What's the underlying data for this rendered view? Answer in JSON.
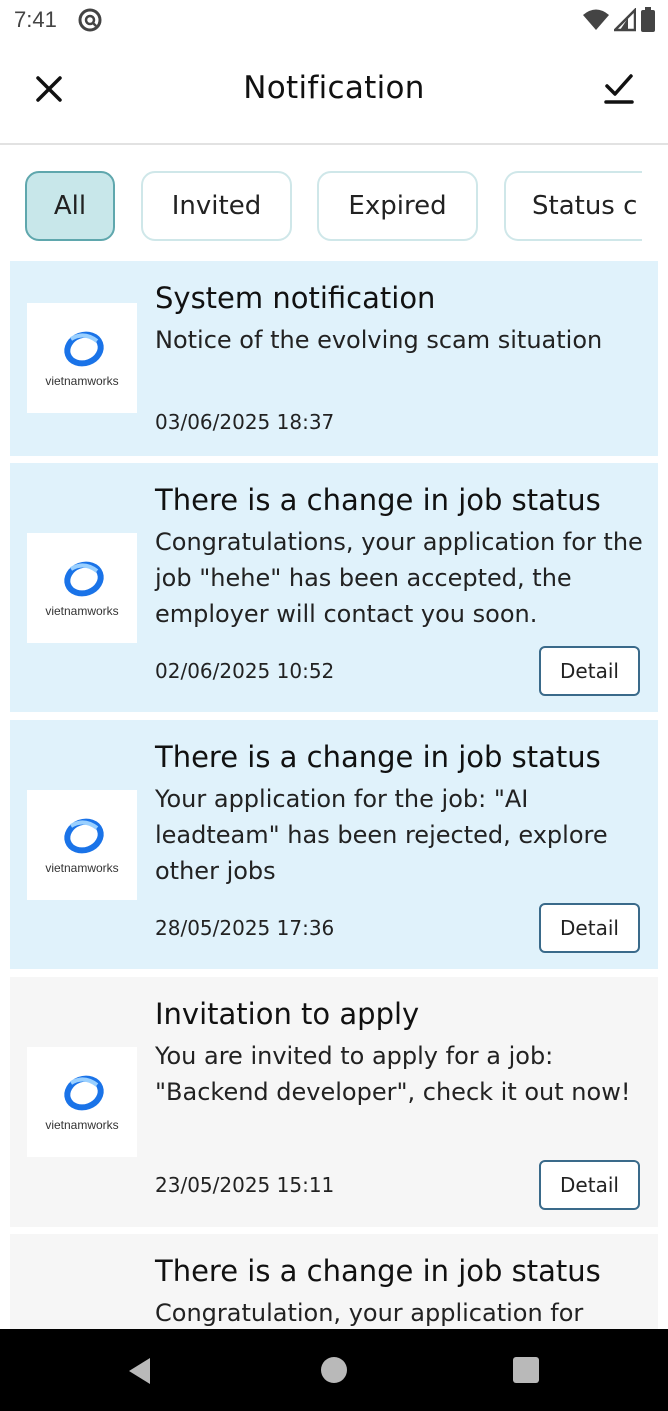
{
  "status_bar": {
    "time": "7:41"
  },
  "app_bar": {
    "title": "Notification",
    "close_icon": "close-icon",
    "check_icon": "mark-all-read-icon"
  },
  "filters": {
    "items": [
      "All",
      "Invited",
      "Expired",
      "Status c"
    ],
    "selected": "All"
  },
  "logo": {
    "text": "vietnamworks",
    "ring_color": "#1a73e8"
  },
  "notifications": [
    {
      "title": "System notification",
      "body": "Notice of the evolving scam situation",
      "date": "03/06/2025 18:37",
      "has_detail": false,
      "read": false
    },
    {
      "title": "There is a change in job status",
      "body": "Congratulations, your application for the job \"hehe\" has been accepted, the employer will contact you soon.",
      "date": "02/06/2025 10:52",
      "detail_label": "Detail",
      "has_detail": true,
      "read": false
    },
    {
      "title": "There is a change in job status",
      "body": "Your application for the job: \"AI leadteam\" has been rejected, explore other jobs",
      "date": "28/05/2025 17:36",
      "detail_label": "Detail",
      "has_detail": true,
      "read": false
    },
    {
      "title": "Invitation to apply",
      "body": "You are invited to apply for a job: \"Backend developer\", check it out now!",
      "date": "23/05/2025 15:11",
      "detail_label": "Detail",
      "has_detail": true,
      "read": true
    },
    {
      "title": "There is a change in job status",
      "body": "Congratulation, your application for",
      "read": true
    }
  ],
  "colors": {
    "unread_bg": "#e0f2fb",
    "read_bg": "#f6f6f6",
    "chip_active": "#c8e7ea",
    "chip_border": "#cfe7e9"
  }
}
